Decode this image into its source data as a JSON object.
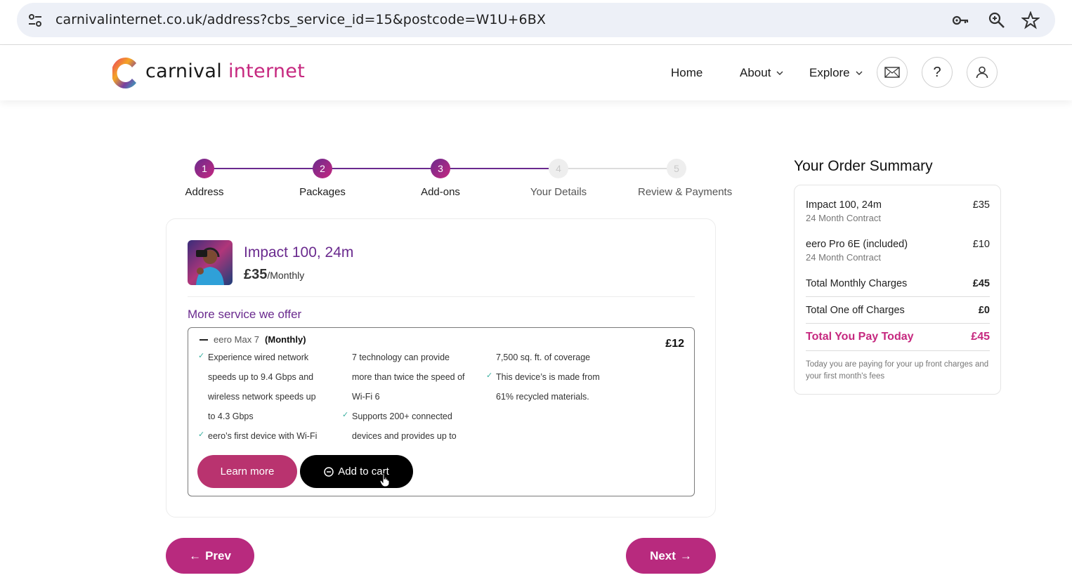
{
  "browser": {
    "url": "carnivalinternet.co.uk/address?cbs_service_id=15&postcode=W1U+6BX",
    "icons": [
      "tune-icon",
      "key-icon",
      "zoom-icon",
      "star-icon"
    ]
  },
  "header": {
    "logo_part1": "carnival",
    "logo_part2": "internet",
    "nav": {
      "home": "Home",
      "about": "About",
      "explore": "Explore"
    },
    "icons": [
      "mail-icon",
      "help-icon",
      "user-icon"
    ],
    "help_glyph": "?"
  },
  "stepper": {
    "steps": [
      {
        "num": "1",
        "label": "Address"
      },
      {
        "num": "2",
        "label": "Packages"
      },
      {
        "num": "3",
        "label": "Add-ons"
      },
      {
        "num": "4",
        "label": "Your Details"
      },
      {
        "num": "5",
        "label": "Review & Payments"
      }
    ],
    "current_step": 3
  },
  "package": {
    "name": "Impact 100, 24m",
    "price": "£35",
    "period": "/Monthly"
  },
  "addons": {
    "title": "More service we offer",
    "item": {
      "name": "eero Max 7",
      "billing": "(Monthly)",
      "price": "£12",
      "features_col1": [
        {
          "tick": true,
          "text": "Experience wired network"
        },
        {
          "tick": false,
          "text": "speeds up to 9.4 Gbps and"
        },
        {
          "tick": false,
          "text": "wireless network speeds up"
        },
        {
          "tick": false,
          "text": "to 4.3 Gbps"
        },
        {
          "tick": true,
          "text": "eero’s first device with Wi-Fi"
        }
      ],
      "features_col2": [
        {
          "tick": false,
          "text": "7 technology can provide"
        },
        {
          "tick": false,
          "text": "more than twice the speed of"
        },
        {
          "tick": false,
          "text": "Wi-Fi 6"
        },
        {
          "tick": true,
          "text": "Supports 200+ connected"
        },
        {
          "tick": false,
          "text": "devices and provides up to"
        }
      ],
      "features_col3": [
        {
          "tick": false,
          "text": "7,500 sq. ft. of coverage"
        },
        {
          "tick": true,
          "text": "This device’s is made from"
        },
        {
          "tick": false,
          "text": "61% recycled materials."
        }
      ],
      "learn_more": "Learn more",
      "add_to_cart": "Add to cart"
    }
  },
  "navigation": {
    "prev": "Prev",
    "next": "Next"
  },
  "summary": {
    "title": "Your Order Summary",
    "items": [
      {
        "name": "Impact 100, 24m",
        "price": "£35",
        "sub": "24 Month Contract"
      },
      {
        "name": "eero Pro 6E (included)",
        "price": "£10",
        "sub": "24 Month Contract"
      }
    ],
    "monthly_label": "Total Monthly Charges",
    "monthly_value": "£45",
    "oneoff_label": "Total One off Charges",
    "oneoff_value": "£0",
    "today_label": "Total You Pay Today",
    "today_value": "£45",
    "note": "Today you are paying for your up front charges and your first month's fees"
  },
  "colors": {
    "brand_pink": "#c6287f",
    "brand_purple": "#6a2a8e",
    "button_pink": "#b82a7e"
  }
}
